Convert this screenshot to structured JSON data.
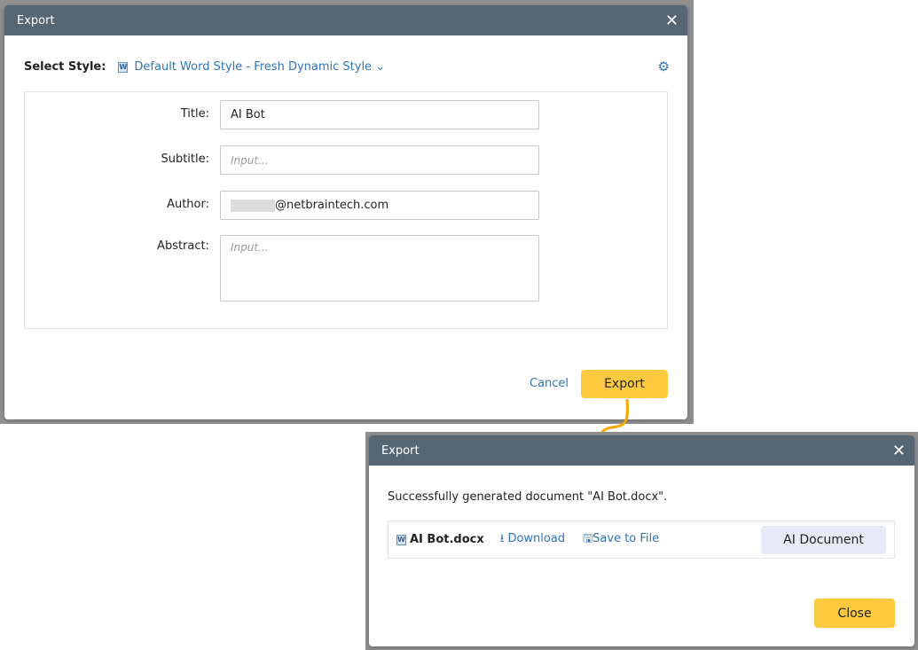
{
  "export_dialog": {
    "title": "Export",
    "select_style_label": "Select Style:",
    "style_value": "Default Word Style - Fresh Dynamic Style",
    "fields": [
      {
        "label": "Title:",
        "value": "AI Bot",
        "placeholder": ""
      },
      {
        "label": "Subtitle:",
        "value": "",
        "placeholder": "Input..."
      },
      {
        "label": "Author:",
        "value": "@netbraintech.com",
        "placeholder": ""
      },
      {
        "label": "Abstract:",
        "value": "",
        "placeholder": "Input..."
      }
    ],
    "cancel": "Cancel",
    "export": "Export"
  },
  "result_dialog": {
    "title": "Export",
    "message": "Successfully generated document \"AI Bot.docx\".",
    "file_name": "AI Bot.docx",
    "download": "Download",
    "save_to_file": "Save to File",
    "ai_document": "AI Document",
    "close": "Close"
  },
  "colors": {
    "accent": "#fdca3f",
    "header": "#566773",
    "link": "#2f73b7"
  }
}
